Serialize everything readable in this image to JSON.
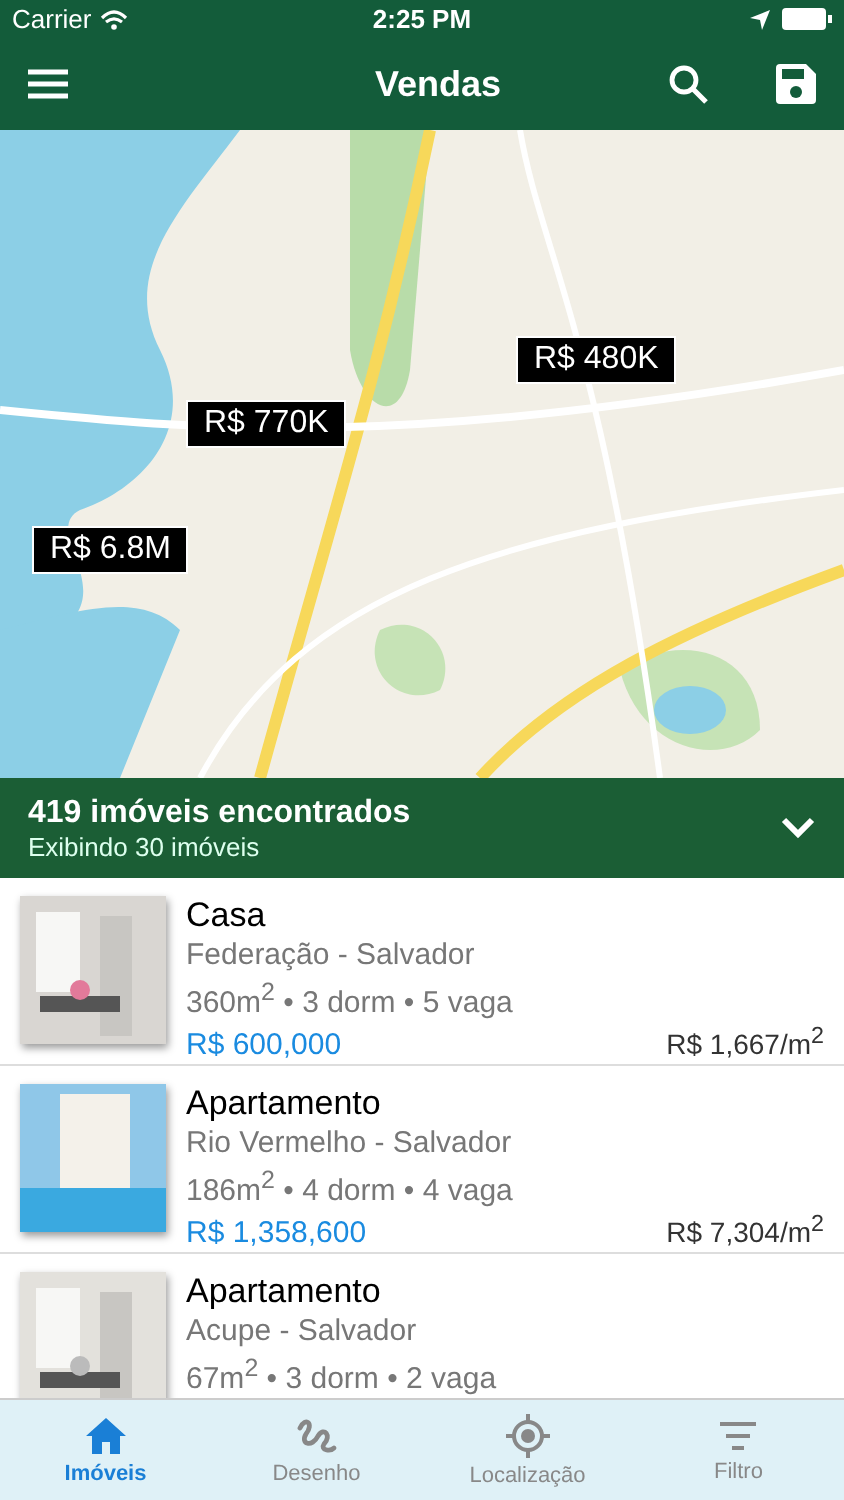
{
  "status_bar": {
    "carrier": "Carrier",
    "time": "2:25 PM"
  },
  "nav": {
    "title": "Vendas"
  },
  "map": {
    "markers": [
      {
        "label": "R$ 480K"
      },
      {
        "label": "R$ 770K"
      },
      {
        "label": "R$ 6.8M"
      }
    ]
  },
  "summary": {
    "title": "419 imóveis encontrados",
    "subtitle": "Exibindo 30 imóveis"
  },
  "listings": [
    {
      "type": "Casa",
      "location": "Federação - Salvador",
      "details": "360m$^{2}$ • 3 dorm • 5 vaga",
      "price": "R$ 600,000",
      "price_per_m2": "R$ 1,667/m$^{2}$"
    },
    {
      "type": "Apartamento",
      "location": "Rio Vermelho - Salvador",
      "details": "186m$^{2}$ • 4 dorm • 4 vaga",
      "price": "R$ 1,358,600",
      "price_per_m2": "R$ 7,304/m$^{2}$"
    },
    {
      "type": "Apartamento",
      "location": "Acupe - Salvador",
      "details": "67m$^{2}$ • 3 dorm • 2 vaga"
    }
  ],
  "tabs": [
    {
      "label": "Imóveis",
      "selected": true
    },
    {
      "label": "Desenho",
      "selected": false
    },
    {
      "label": "Localização",
      "selected": false
    },
    {
      "label": "Filtro",
      "selected": false
    }
  ]
}
